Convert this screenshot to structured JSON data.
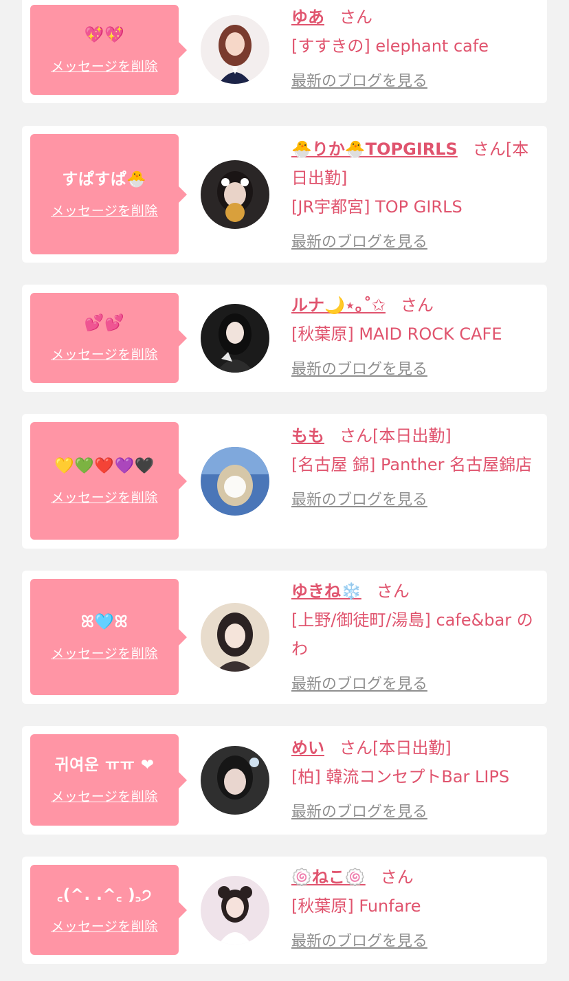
{
  "common": {
    "delete_label": "メッセージを削除",
    "blog_label": "最新のブログを見る",
    "san_suffix": "さん",
    "accent_color": "#e0546e",
    "bubble_color": "#ff95a5",
    "link_gray": "#8f8f8f"
  },
  "entries": [
    {
      "message": "💖💖",
      "name": "ゆあ",
      "suffix": "さん",
      "shop": "[すすきの] elephant cafe"
    },
    {
      "message": "すぱすぱ🐣",
      "name": "🐣りか🐣TOPGIRLS",
      "suffix": "さん[本日出勤]",
      "shop": "[JR宇都宮] TOP GIRLS"
    },
    {
      "message": "💕💕",
      "name": "ルナ🌙⋆｡˚✩",
      "suffix": "さん",
      "shop": "[秋葉原] MAID ROCK CAFE"
    },
    {
      "message": "💛💚❤️💜🖤",
      "name": "もも",
      "suffix": "さん[本日出勤]",
      "shop": "[名古屋 錦] Panther 名古屋錦店"
    },
    {
      "message": "ꕤ🩵ꕤ",
      "name": "ゆきね❄️",
      "suffix": "さん",
      "shop": "[上野/御徒町/湯島] cafe&bar のわ"
    },
    {
      "message": "귀여운 ㅠㅠ ❤",
      "name": "めい",
      "suffix": "さん[本日出勤]",
      "shop": "[柏] 韓流コンセプトBar LIPS"
    },
    {
      "message": "꜀(^. .^꜀ )꜆੭",
      "name": "🍥ねこ🍥",
      "suffix": "さん",
      "shop": "[秋葉原] Funfare"
    }
  ]
}
